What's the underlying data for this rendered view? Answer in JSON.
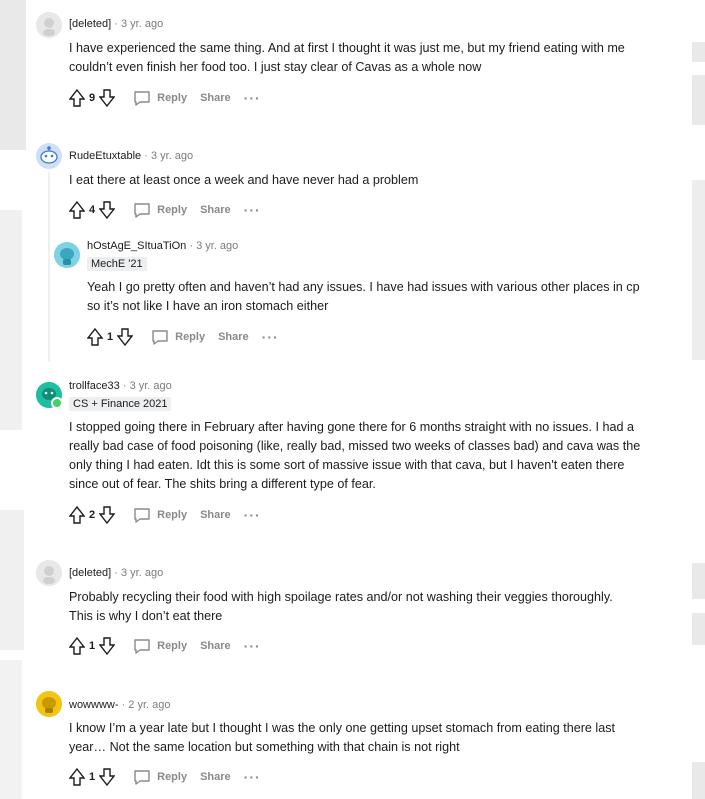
{
  "colors": {
    "meta": "#7c7c7c",
    "action": "#878a8c",
    "flair_bg": "#edeff1",
    "online": "#46d160"
  },
  "comments": [
    {
      "author": "[deleted]",
      "time": "3 yr. ago",
      "text": "I have experienced the same thing. And at first I thought it was just me, but my friend eating with me couldn’t even finish her food too. I just stay clear of Cavas as a whole now",
      "score": "9",
      "avatar": "deleted-avatar-icon"
    },
    {
      "author": "RudeEtuxtable",
      "time": "3 yr. ago",
      "text": "I eat there at least once a week and have never had a problem",
      "score": "4",
      "avatar": "snoo-blue-avatar-icon"
    },
    {
      "author": "hOstAgE_SItuaTiOn",
      "time": "3 yr. ago",
      "flair": "MechE '21",
      "text": "Yeah I go pretty often and haven’t had any issues. I have had issues with various other places in cp so it’s not like I have an iron stomach either",
      "score": "1",
      "avatar": "teal-avatar-icon"
    },
    {
      "author": "trollface33",
      "time": "3 yr. ago",
      "flair": "CS + Finance 2021",
      "text": "I stopped going there in February after having gone there for 6 months straight with no issues. I had a really bad case of food poisoning (like, really bad, missed two weeks of classes bad) and cava was the only thing I had eaten. Idt this is some sort of massive issue with that cava, but I haven't eaten there since out of fear. The shits bring a different type of fear.",
      "score": "2",
      "avatar": "green-avatar-icon"
    },
    {
      "author": "[deleted]",
      "time": "3 yr. ago",
      "text": "Probably recycling their food with high spoilage rates and/or not washing their veggies thoroughly. This is why I don’t eat there",
      "score": "1",
      "avatar": "deleted-avatar-icon"
    },
    {
      "author": "wowwww-",
      "time": "2 yr. ago",
      "text": "I know I’m a year late but I thought I was the only one getting upset stomach from eating there last year… Not the same location but something with that chain is not right",
      "score": "1",
      "avatar": "yellow-avatar-icon"
    }
  ],
  "labels": {
    "reply": "Reply",
    "share": "Share",
    "more": "···",
    "dot": "·"
  }
}
